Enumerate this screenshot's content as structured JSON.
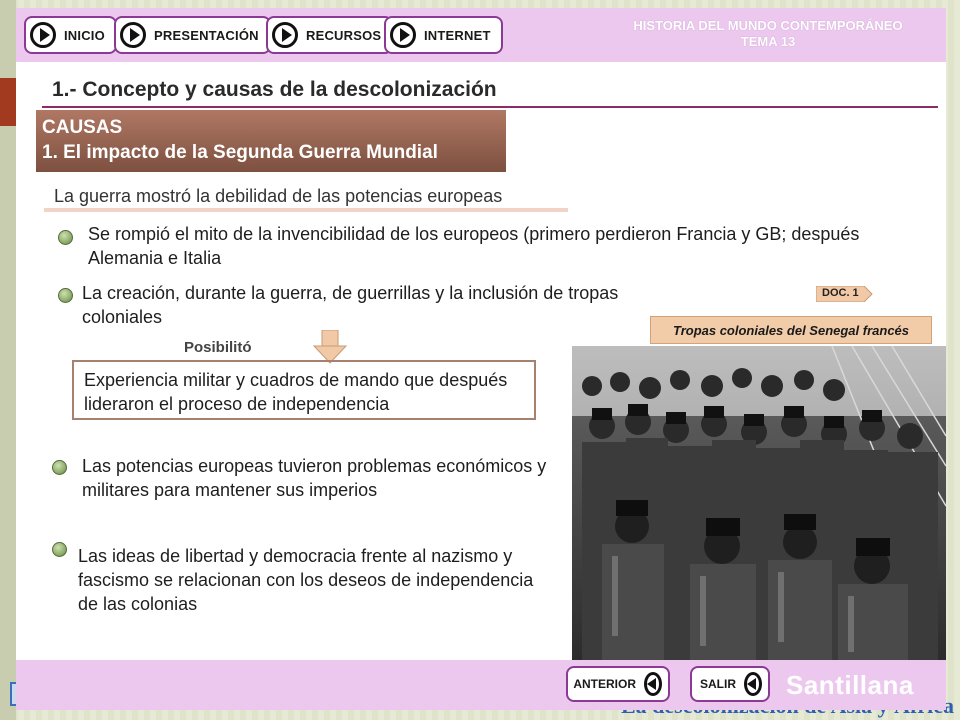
{
  "nav": {
    "inicio": "INICIO",
    "presentacion": "PRESENTACIÓN",
    "recursos": "RECURSOS",
    "internet": "INTERNET"
  },
  "course": {
    "line1": "HISTORIA DEL MUNDO CONTEMPORÁNEO",
    "line2": "TEMA 13"
  },
  "section_title": "1.- Concepto y causas de la descolonización",
  "causas": {
    "line1": "CAUSAS",
    "line2": "1. El impacto de la Segunda Guerra Mundial"
  },
  "subhead": "La guerra mostró la debilidad de las potencias europeas",
  "points": {
    "p1": "Se rompió el mito de la invencibilidad de los europeos (primero perdieron Francia y GB; después Alemania e Italia",
    "p2": "La creación, durante la guerra, de guerrillas y la inclusión de tropas coloniales",
    "p3": "Las potencias europeas tuvieron problemas económicos y militares para mantener sus imperios",
    "p4": "Las ideas de libertad y democracia frente al nazismo y fascismo se relacionan con los deseos de independencia de las colonias"
  },
  "posibilito": "Posibilitó",
  "experiencia": "Experiencia militar y cuadros de mando que después lideraron el proceso de independencia",
  "doc_tag": "DOC. 1",
  "photo_caption": "Tropas coloniales del Senegal francés",
  "footer": {
    "anterior": "ANTERIOR",
    "salir": "SALIR",
    "brand": "Santillana"
  },
  "background_title": "La descolonización de Asia y África",
  "colors": {
    "topbar": "#ecc8ef",
    "accent": "#8b3a94",
    "causas": "#9a6653",
    "rule": "#8c2b6a"
  },
  "icons": {
    "nav_button": "play-circle-icon",
    "footer_button": "back-circle-icon",
    "bullet": "green-bullet-icon",
    "arrow": "down-arrow-icon"
  }
}
